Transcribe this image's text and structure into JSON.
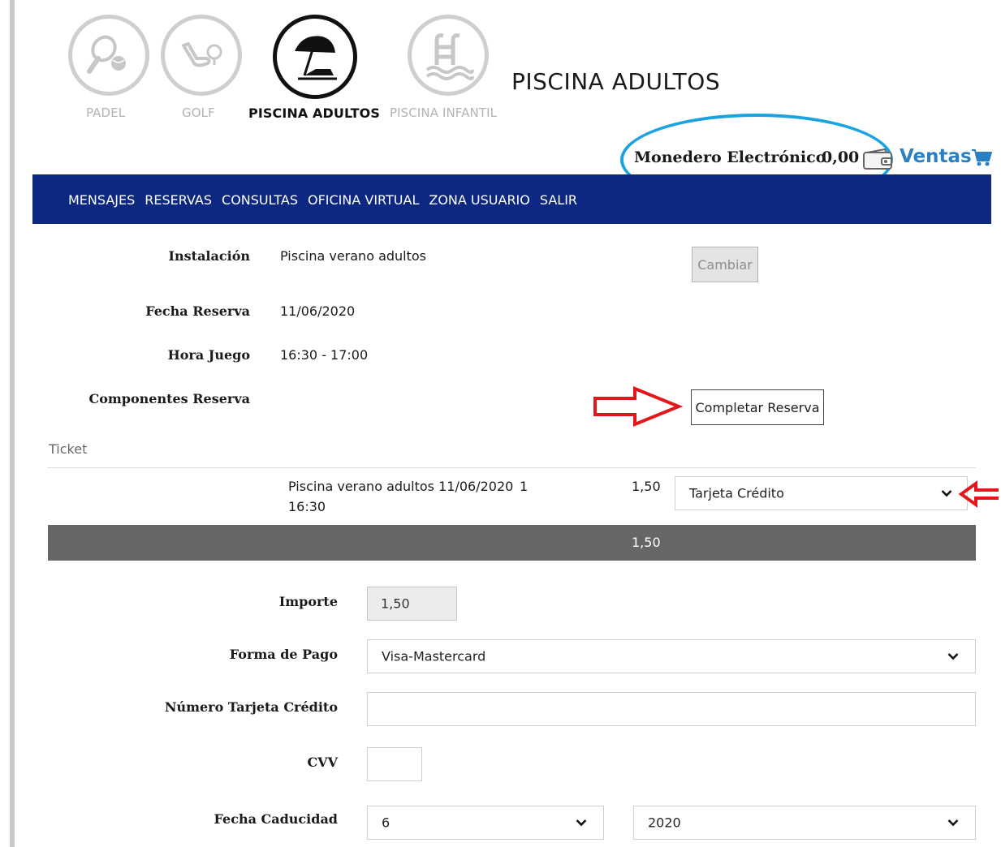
{
  "categories": [
    {
      "label": "PADEL",
      "active": false,
      "icon": "padel-icon"
    },
    {
      "label": "GOLF",
      "active": false,
      "icon": "golf-icon"
    },
    {
      "label": "PISCINA ADULTOS",
      "active": true,
      "icon": "beach-umbrella-icon"
    },
    {
      "label": "PISCINA INFANTIL",
      "active": false,
      "icon": "pool-ladder-icon"
    }
  ],
  "page_title": "PISCINA ADULTOS",
  "wallet": {
    "label": "Monedero Electrónico",
    "value": "0,00",
    "icon": "wallet-icon"
  },
  "sales": {
    "label": "Ventas",
    "icon": "cart-icon"
  },
  "nav": [
    "MENSAJES",
    "RESERVAS",
    "CONSULTAS",
    "OFICINA VIRTUAL",
    "ZONA USUARIO",
    "SALIR"
  ],
  "booking": {
    "installation_label": "Instalación",
    "installation_value": "Piscina verano adultos",
    "change_button": "Cambiar",
    "date_label": "Fecha Reserva",
    "date_value": "11/06/2020",
    "time_label": "Hora Juego",
    "time_value": "16:30 - 17:00",
    "components_label": "Componentes Reserva",
    "complete_button": "Completar Reserva"
  },
  "ticket": {
    "label": "Ticket",
    "row": {
      "description_line1": "Piscina verano adultos 11/06/2020",
      "description_line2": "16:30",
      "quantity": "1",
      "price": "1,50",
      "payment_method": "Tarjeta Crédito"
    },
    "total": "1,50"
  },
  "payment": {
    "amount_label": "Importe",
    "amount_value": "1,50",
    "method_label": "Forma de Pago",
    "method_value": "Visa-Mastercard",
    "card_label": "Número Tarjeta Crédito",
    "card_value": "",
    "cvv_label": "CVV",
    "cvv_value": "",
    "expiry_label": "Fecha Caducidad",
    "expiry_month": "6",
    "expiry_year": "2020"
  },
  "colors": {
    "nav_bg": "#0d2880",
    "accent_blue": "#2c7fc0",
    "annotation_red": "#e3171b",
    "annotation_cyan": "#1aa3e0",
    "total_bar": "#666666"
  }
}
